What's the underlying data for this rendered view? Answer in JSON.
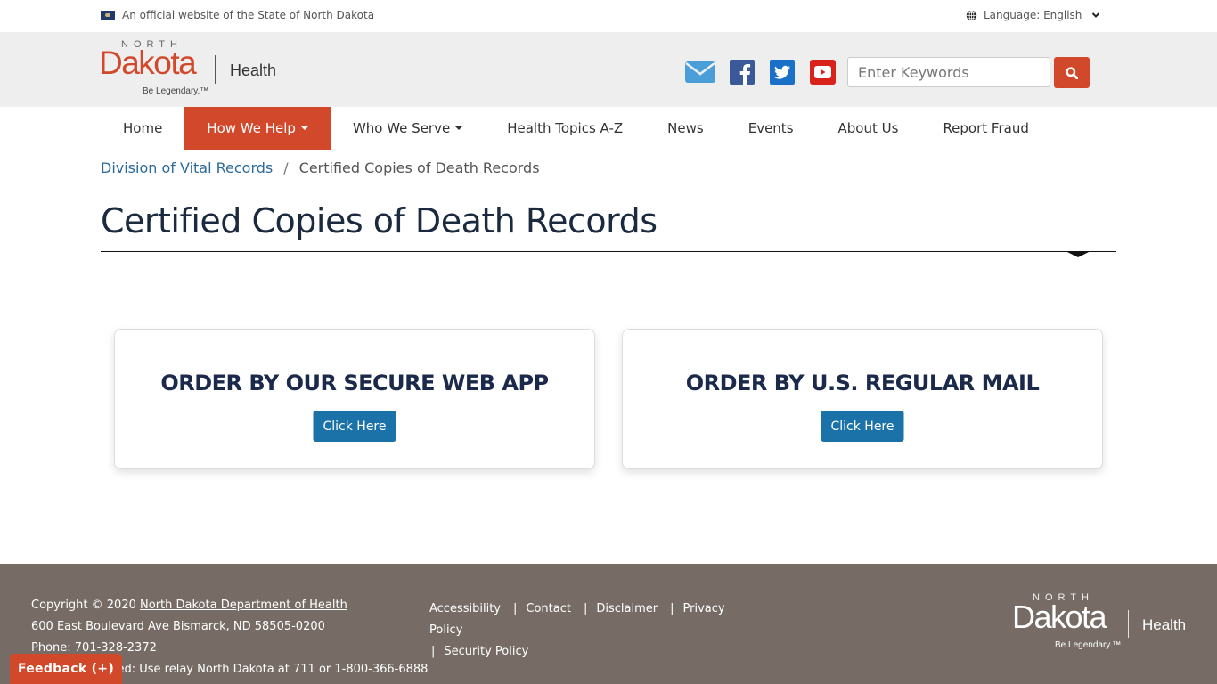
{
  "official_banner": {
    "text": "An official website of the State of North Dakota",
    "language_label": "Language: English"
  },
  "logo": {
    "north": "NORTH",
    "dakota": "Dakota",
    "tagline": "Be Legendary.™",
    "department": "Health"
  },
  "social": [
    {
      "name": "email",
      "icon": "envelope-icon",
      "color": "#4a9fd8"
    },
    {
      "name": "facebook",
      "icon": "facebook-icon",
      "color": "#3b5998"
    },
    {
      "name": "twitter",
      "icon": "twitter-icon",
      "color": "#1a6fc9"
    },
    {
      "name": "youtube",
      "icon": "youtube-icon",
      "color": "#d9221c"
    }
  ],
  "search": {
    "placeholder": "Enter Keywords",
    "value": ""
  },
  "nav": {
    "items": [
      {
        "label": "Home",
        "active": false,
        "dropdown": false
      },
      {
        "label": "How We Help",
        "active": true,
        "dropdown": true
      },
      {
        "label": "Who We Serve",
        "active": false,
        "dropdown": true
      },
      {
        "label": "Health Topics A-Z",
        "active": false,
        "dropdown": false
      },
      {
        "label": "News",
        "active": false,
        "dropdown": false
      },
      {
        "label": "Events",
        "active": false,
        "dropdown": false
      },
      {
        "label": "About Us",
        "active": false,
        "dropdown": false
      },
      {
        "label": "Report Fraud",
        "active": false,
        "dropdown": false
      }
    ]
  },
  "breadcrumb": {
    "parent": "Division of Vital Records",
    "separator": "/",
    "current": "Certified Copies of Death Records"
  },
  "page": {
    "title": "Certified Copies of Death Records"
  },
  "cards": [
    {
      "heading": "ORDER BY OUR SECURE WEB APP",
      "button": "Click Here"
    },
    {
      "heading": "ORDER BY U.S. REGULAR MAIL",
      "button": "Click Here"
    }
  ],
  "footer": {
    "copyright_prefix": "Copyright © 2020 ",
    "copyright_link": "North Dakota Department of Health",
    "address": "600 East Boulevard Ave Bismarck, ND 58505-0200",
    "phone": "Phone: 701-328-2372",
    "relay": "Hearing impaired: Use relay North Dakota at 711 or 1-800-366-6888",
    "links": [
      "Accessibility",
      "Contact",
      "Disclaimer",
      "Privacy Policy",
      "Security Policy"
    ],
    "link_separator": "|"
  },
  "feedback": {
    "label": "Feedback (+)"
  },
  "colors": {
    "brand_orange": "#d2482a",
    "button_blue": "#1a72a8",
    "footer_bg": "#766c65",
    "header_bg": "#eeeeee",
    "link_blue": "#2b6a99"
  }
}
